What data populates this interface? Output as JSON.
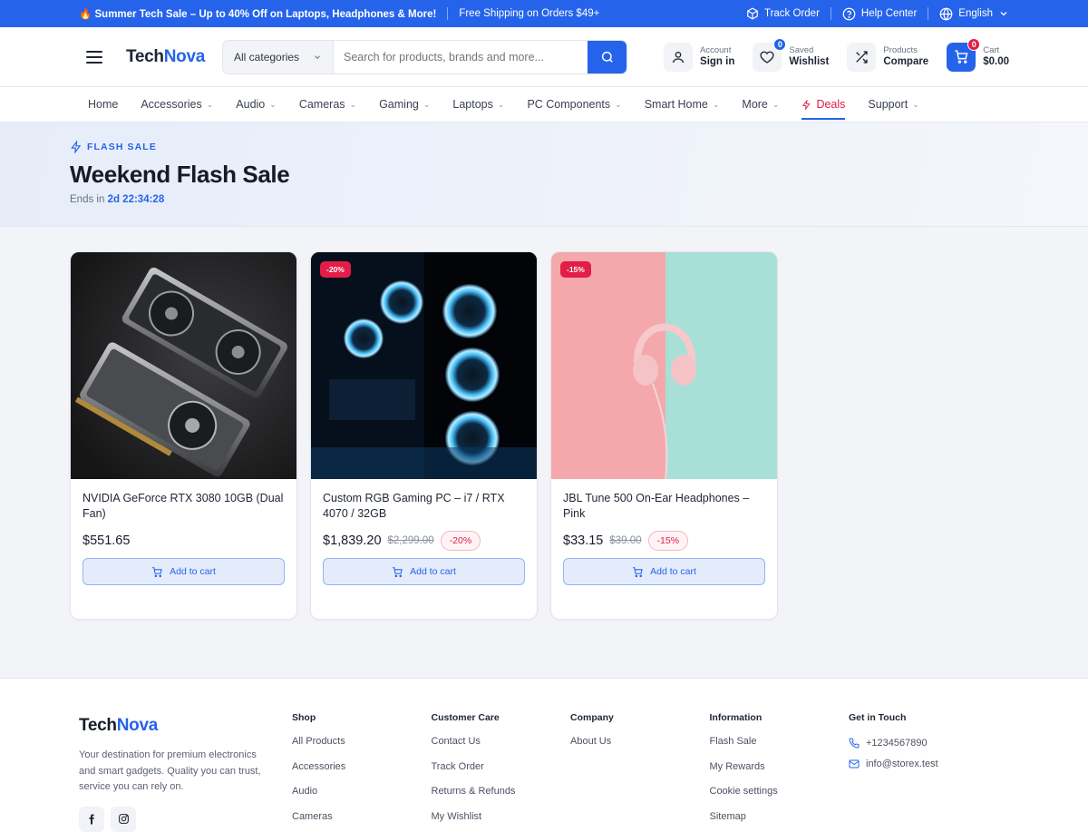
{
  "topbar": {
    "promo": "🔥 Summer Tech Sale – Up to 40% Off on Laptops, Headphones & More!",
    "shipping": "Free Shipping on Orders $49+",
    "track_order": "Track Order",
    "help_center": "Help Center",
    "language": "English"
  },
  "header": {
    "logo_a": "Tech",
    "logo_b": "Nova",
    "category_select": "All categories",
    "search_placeholder": "Search for products, brands and more...",
    "account_small": "Account",
    "account_big": "Sign in",
    "wishlist_small": "Saved",
    "wishlist_big": "Wishlist",
    "wishlist_count": "0",
    "compare_small": "Products",
    "compare_big": "Compare",
    "cart_small": "Cart",
    "cart_big": "$0.00",
    "cart_count": "0"
  },
  "nav": {
    "home": "Home",
    "accessories": "Accessories",
    "audio": "Audio",
    "cameras": "Cameras",
    "gaming": "Gaming",
    "laptops": "Laptops",
    "pc_components": "PC Components",
    "smart_home": "Smart Home",
    "more": "More",
    "deals": "Deals",
    "support": "Support"
  },
  "hero": {
    "tag": "FLASH SALE",
    "title": "Weekend Flash Sale",
    "ends_label": "Ends in",
    "countdown": "2d 22:34:28"
  },
  "products": [
    {
      "name": "NVIDIA GeForce RTX 3080 10GB (Dual Fan)",
      "price": "$551.65",
      "old_price": "",
      "discount": "",
      "cta": "Add to cart"
    },
    {
      "name": "Custom RGB Gaming PC – i7 / RTX 4070 / 32GB",
      "price": "$1,839.20",
      "old_price": "$2,299.00",
      "discount": "-20%",
      "cta": "Add to cart"
    },
    {
      "name": "JBL Tune 500 On-Ear Headphones – Pink",
      "price": "$33.15",
      "old_price": "$39.00",
      "discount": "-15%",
      "cta": "Add to cart"
    }
  ],
  "footer": {
    "logo_a": "Tech",
    "logo_b": "Nova",
    "description": "Your destination for premium electronics and smart gadgets. Quality you can trust, service you can rely on.",
    "shop": {
      "title": "Shop",
      "links": [
        "All Products",
        "Accessories",
        "Audio",
        "Cameras"
      ]
    },
    "care": {
      "title": "Customer Care",
      "links": [
        "Contact Us",
        "Track Order",
        "Returns & Refunds",
        "My Wishlist"
      ]
    },
    "company": {
      "title": "Company",
      "links": [
        "About Us"
      ]
    },
    "info": {
      "title": "Information",
      "links": [
        "Flash Sale",
        "My Rewards",
        "Cookie settings",
        "Sitemap"
      ]
    },
    "touch": {
      "title": "Get in Touch",
      "phone": "+1234567890",
      "email": "info@storex.test"
    }
  },
  "colors": {
    "brand": "#2563eb",
    "sale": "#e11d48"
  },
  "icons": [
    "box-icon",
    "help-icon",
    "globe-icon",
    "chevron-down-icon",
    "menu-icon",
    "search-icon",
    "user-icon",
    "heart-icon",
    "shuffle-icon",
    "cart-icon",
    "bolt-icon",
    "phone-icon",
    "mail-icon",
    "facebook-icon",
    "instagram-icon"
  ]
}
